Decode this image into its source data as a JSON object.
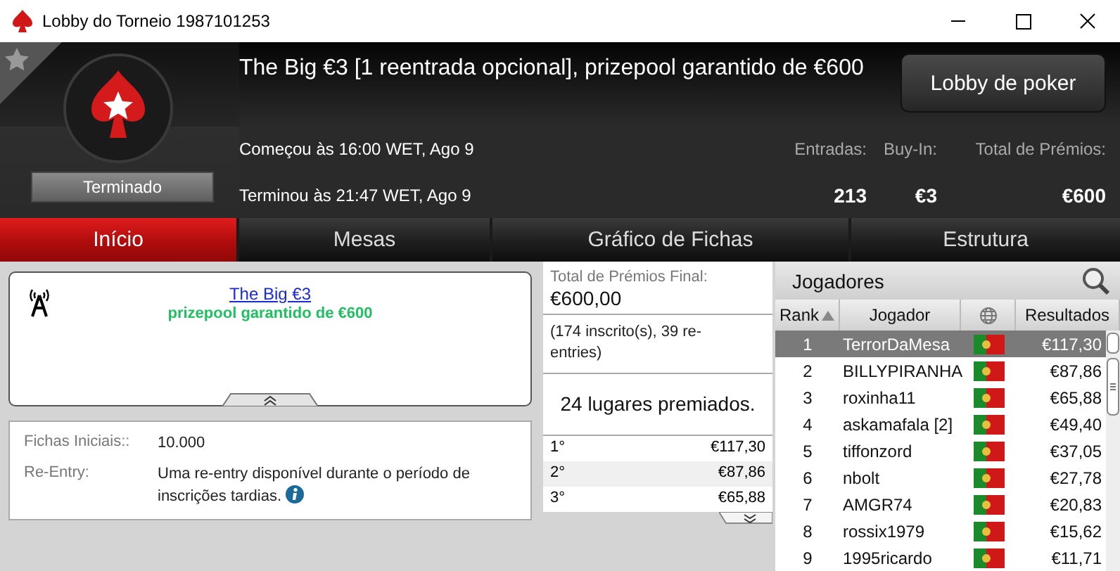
{
  "window": {
    "title": "Lobby do Torneio 1987101253"
  },
  "header": {
    "favorite": false,
    "status": "Terminado",
    "title": "The Big €3 [1 reentrada opcional], prizepool garantido de €600",
    "lobby_button": "Lobby de poker",
    "started": "Começou às 16:00 WET, Ago 9",
    "ended": "Terminou às 21:47 WET, Ago 9",
    "stats": [
      {
        "label": "Entradas:",
        "value": "213"
      },
      {
        "label": "Buy-In:",
        "value": "€3"
      },
      {
        "label": "Total de Prémios:",
        "value": "€600"
      }
    ]
  },
  "tabs": [
    {
      "label": "Início",
      "selected": true
    },
    {
      "label": "Mesas",
      "selected": false
    },
    {
      "label": "Gráfico de Fichas",
      "selected": false
    },
    {
      "label": "Estrutura",
      "selected": false
    }
  ],
  "news": {
    "link": "The Big €3",
    "subtitle": "prizepool garantido de €600"
  },
  "details": [
    {
      "label": "Fichas Iniciais::",
      "value": "10.000"
    },
    {
      "label": "Re-Entry:",
      "value": "Uma re-entry disponível durante o período de inscrições tardias.",
      "info": true
    }
  ],
  "prizes": {
    "label": "Total de Prémios Final:",
    "total": "€600,00",
    "entrants": "(174 inscrito(s), 39 re-entries)",
    "places": "24 lugares premiados.",
    "rows": [
      {
        "place": "1°",
        "amount": "€117,30"
      },
      {
        "place": "2°",
        "amount": "€87,86"
      },
      {
        "place": "3°",
        "amount": "€65,88"
      }
    ]
  },
  "players": {
    "title": "Jogadores",
    "columns": [
      "Rank",
      "Jogador",
      "Resultados"
    ],
    "rows": [
      {
        "rank": "1",
        "name": "TerrorDaMesa",
        "result": "€117,30",
        "selected": true
      },
      {
        "rank": "2",
        "name": "BILLYPIRANHA",
        "result": "€87,86",
        "selected": false
      },
      {
        "rank": "3",
        "name": "roxinha11",
        "result": "€65,88",
        "selected": false
      },
      {
        "rank": "4",
        "name": "askamafala [2]",
        "result": "€49,40",
        "selected": false
      },
      {
        "rank": "5",
        "name": "tiffonzord",
        "result": "€37,05",
        "selected": false
      },
      {
        "rank": "6",
        "name": "nbolt",
        "result": "€27,78",
        "selected": false
      },
      {
        "rank": "7",
        "name": "AMGR74",
        "result": "€20,83",
        "selected": false
      },
      {
        "rank": "8",
        "name": "rossix1979",
        "result": "€15,62",
        "selected": false
      },
      {
        "rank": "9",
        "name": "1995ricardo",
        "result": "€11,71",
        "selected": false
      }
    ]
  }
}
